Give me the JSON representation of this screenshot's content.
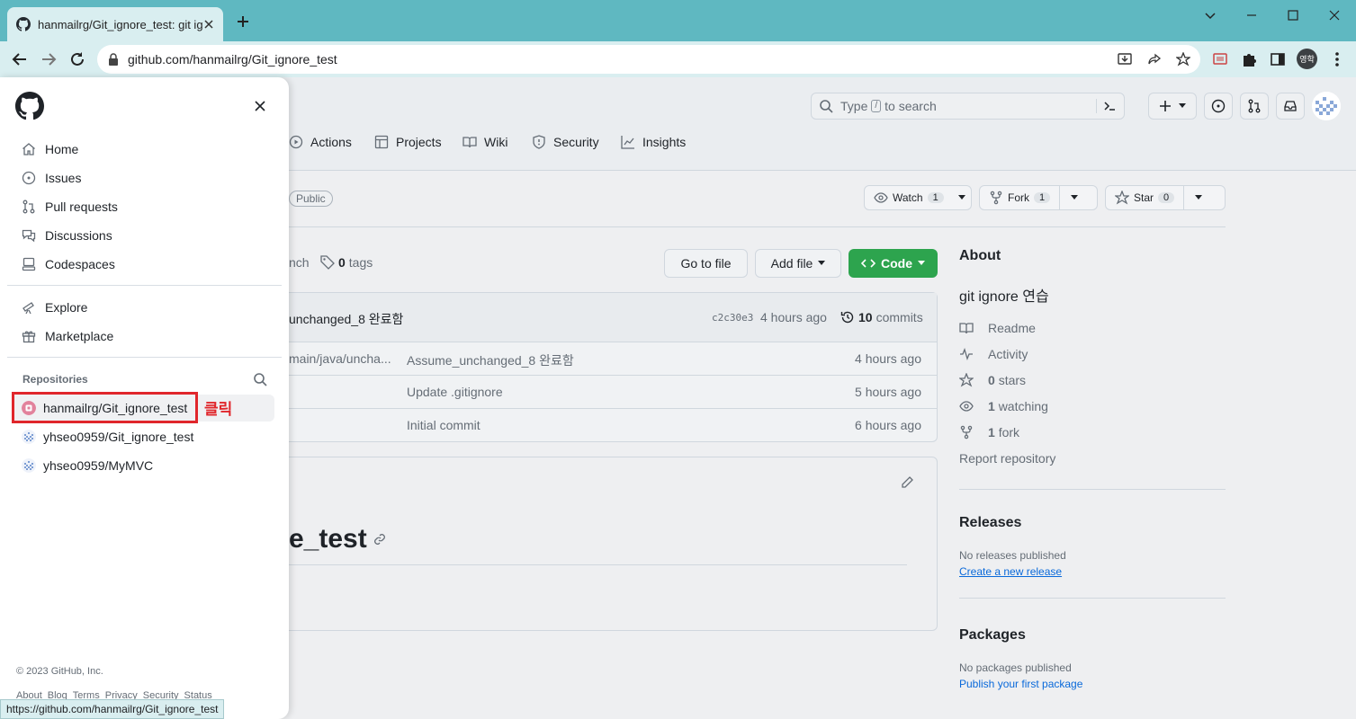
{
  "browser": {
    "tab_title": "hanmailrg/Git_ignore_test: git ig",
    "url": "github.com/hanmailrg/Git_ignore_test",
    "profile_label": "영학",
    "status_url": "https://github.com/hanmailrg/Git_ignore_test"
  },
  "header": {
    "search_prefix": "Type",
    "search_key": "/",
    "search_suffix": "to search"
  },
  "reponav": {
    "actions": "Actions",
    "projects": "Projects",
    "wiki": "Wiki",
    "security": "Security",
    "insights": "Insights"
  },
  "repo": {
    "visibility": "Public",
    "watch_label": "Watch",
    "watch_count": "1",
    "fork_label": "Fork",
    "fork_count": "1",
    "star_label": "Star",
    "star_count": "0",
    "branch_text": "nch",
    "tags_count": "0",
    "tags_label": "tags",
    "go_to_file": "Go to file",
    "add_file": "Add file",
    "code": "Code",
    "latest_commit_msg": "unchanged_8 완료함",
    "latest_commit_hash": "c2c30e3",
    "latest_commit_time": "4 hours ago",
    "commits_count": "10",
    "commits_label": "commits",
    "files": [
      {
        "name": "main/java/uncha...",
        "message": "Assume_unchanged_8 완료함",
        "time": "4 hours ago"
      },
      {
        "name": "",
        "message": "Update .gitignore",
        "time": "5 hours ago"
      },
      {
        "name": "",
        "message": "Initial commit",
        "time": "6 hours ago"
      }
    ],
    "readme_title": "e_test"
  },
  "about": {
    "heading": "About",
    "description": "git ignore 연습",
    "readme": "Readme",
    "activity": "Activity",
    "stars_count": "0",
    "stars_label": "stars",
    "watching_count": "1",
    "watching_label": "watching",
    "fork_count": "1",
    "fork_label": "fork",
    "report": "Report repository",
    "releases_heading": "Releases",
    "no_releases": "No releases published",
    "create_release": "Create a new release",
    "packages_heading": "Packages",
    "no_packages": "No packages published",
    "publish_package": "Publish your first package"
  },
  "drawer": {
    "items": [
      {
        "label": "Home"
      },
      {
        "label": "Issues"
      },
      {
        "label": "Pull requests"
      },
      {
        "label": "Discussions"
      },
      {
        "label": "Codespaces"
      },
      {
        "label": "Explore"
      },
      {
        "label": "Marketplace"
      }
    ],
    "repos_heading": "Repositories",
    "repos": [
      {
        "label": "hanmailrg/Git_ignore_test"
      },
      {
        "label": "yhseo0959/Git_ignore_test"
      },
      {
        "label": "yhseo0959/MyMVC"
      }
    ],
    "annotation": "클릭",
    "copyright": "© 2023 GitHub, Inc.",
    "footer_links": [
      "About",
      "Blog",
      "Terms",
      "Privacy",
      "Security",
      "Status"
    ]
  },
  "colors": {
    "tabbar": "#5fb8c1",
    "accent_green": "#2da44e",
    "link_blue": "#0969da",
    "highlight_red": "#e0262b"
  }
}
